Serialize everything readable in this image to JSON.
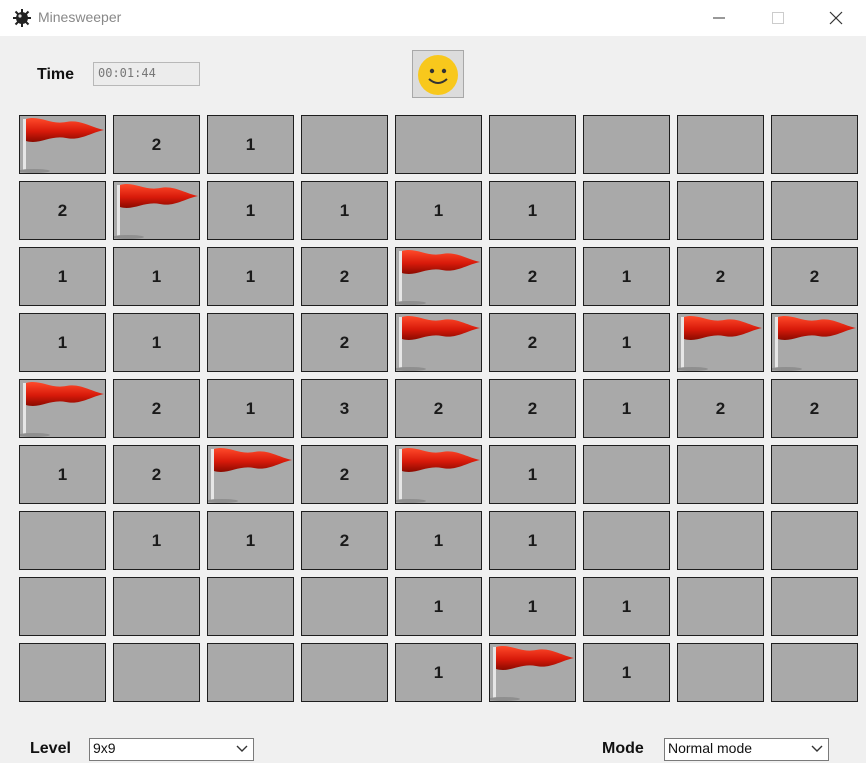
{
  "window": {
    "title": "Minesweeper",
    "icon": "mine-icon",
    "controls": [
      "minimize-icon",
      "maximize-icon",
      "close-icon"
    ]
  },
  "header": {
    "time_label": "Time",
    "time_value": "00:01:44",
    "reset_icon": "smiley-face-icon"
  },
  "board": {
    "rows": [
      [
        "F",
        "2",
        "1",
        "",
        "",
        "",
        "",
        "",
        ""
      ],
      [
        "2",
        "F",
        "1",
        "1",
        "1",
        "1",
        "",
        "",
        ""
      ],
      [
        "1",
        "1",
        "1",
        "2",
        "F",
        "2",
        "1",
        "2",
        "2"
      ],
      [
        "1",
        "1",
        "",
        "2",
        "F",
        "2",
        "1",
        "F",
        "F"
      ],
      [
        "F",
        "2",
        "1",
        "3",
        "2",
        "2",
        "1",
        "2",
        "2"
      ],
      [
        "1",
        "2",
        "F",
        "2",
        "F",
        "1",
        "",
        "",
        ""
      ],
      [
        "",
        "1",
        "1",
        "2",
        "1",
        "1",
        "",
        "",
        ""
      ],
      [
        "",
        "",
        "",
        "",
        "1",
        "1",
        "1",
        "",
        ""
      ],
      [
        "",
        "",
        "",
        "",
        "1",
        "F",
        "1",
        "",
        ""
      ]
    ],
    "flag_icon": "flag-icon",
    "cell_color": "#a9a9a9"
  },
  "footer": {
    "level_label": "Level",
    "level_value": "9x9",
    "mode_label": "Mode",
    "mode_value": "Normal mode"
  }
}
